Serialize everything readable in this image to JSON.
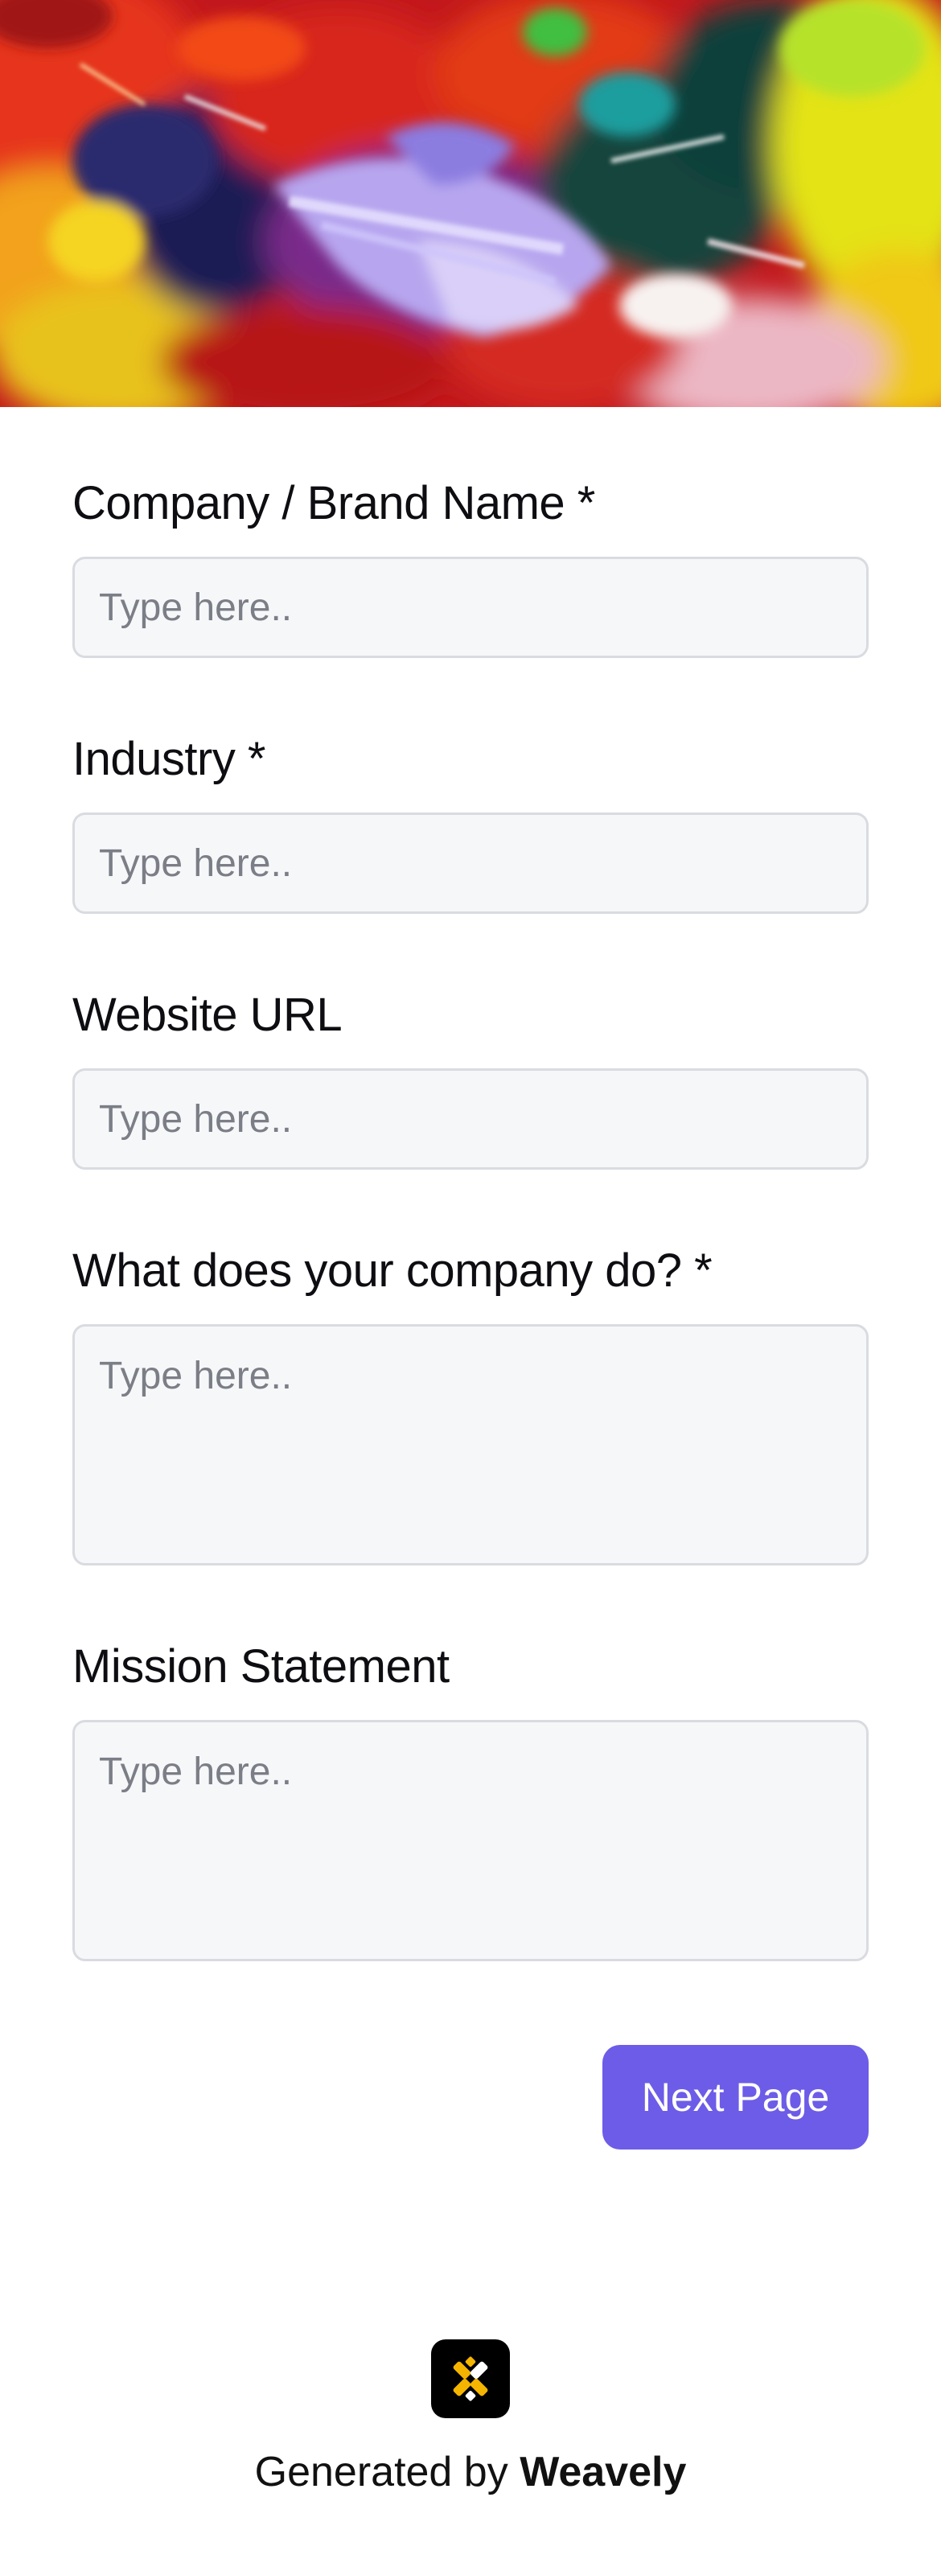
{
  "hero": {
    "image_name": "painting-palette-image"
  },
  "form": {
    "fields": [
      {
        "label": "Company / Brand Name *",
        "placeholder": "Type here..",
        "type": "input"
      },
      {
        "label": "Industry *",
        "placeholder": "Type here..",
        "type": "input"
      },
      {
        "label": "Website URL",
        "placeholder": "Type here..",
        "type": "input"
      },
      {
        "label": "What does your company do? *",
        "placeholder": "Type here..",
        "type": "textarea"
      },
      {
        "label": "Mission Statement",
        "placeholder": "Type here..",
        "type": "textarea"
      }
    ],
    "next_label": "Next Page"
  },
  "footer": {
    "prefix": "Generated by",
    "brand": "Weavely",
    "logo_icon": "weavely-logo-icon"
  },
  "colors": {
    "accent": "#6d5ce7",
    "input_bg": "#f6f7f9",
    "input_border": "#d9dbe0",
    "logo_yellow": "#f5b400"
  }
}
